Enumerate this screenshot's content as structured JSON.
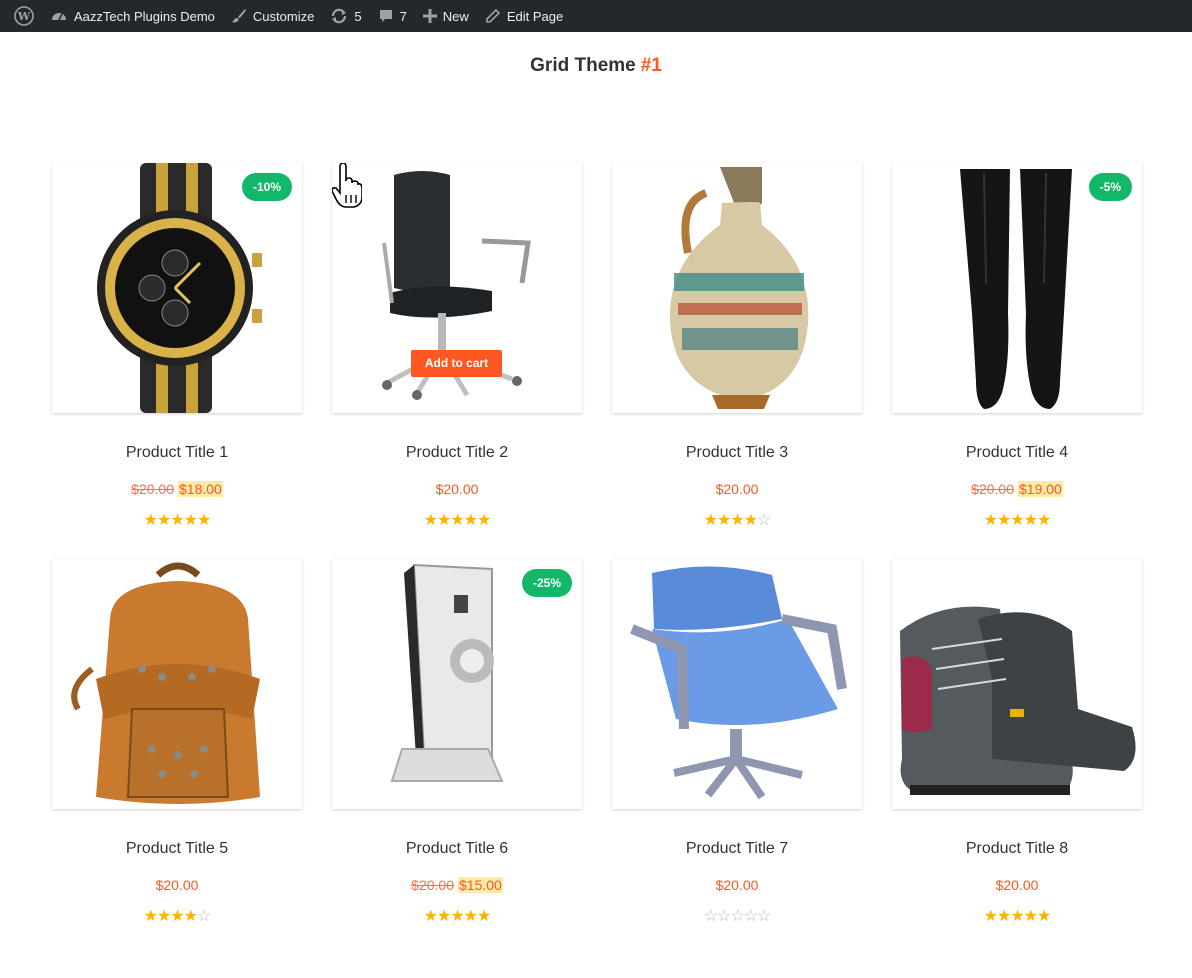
{
  "adminbar": {
    "site_name": "AazzTech Plugins Demo",
    "customize": "Customize",
    "updates": "5",
    "comments": "7",
    "new": "New",
    "edit": "Edit Page"
  },
  "heading": {
    "text": "Grid Theme",
    "accent": "#1"
  },
  "colors": {
    "accent": "#ff5722",
    "badge": "#12b76a",
    "star": "#ffb300"
  },
  "hover_button": "Add to cart",
  "products": [
    {
      "title": "Product Title 1",
      "old_price": "$20.00",
      "price": "$18.00",
      "badge": "-10%",
      "rating": 5,
      "image": "watch"
    },
    {
      "title": "Product Title 2",
      "old_price": "",
      "price": "$20.00",
      "badge": "",
      "rating": 5,
      "image": "office-chair"
    },
    {
      "title": "Product Title 3",
      "old_price": "",
      "price": "$20.00",
      "badge": "",
      "rating": 4,
      "image": "vase"
    },
    {
      "title": "Product Title 4",
      "old_price": "$20.00",
      "price": "$19.00",
      "badge": "-5%",
      "rating": 5,
      "image": "boots"
    },
    {
      "title": "Product Title 5",
      "old_price": "",
      "price": "$20.00",
      "badge": "",
      "rating": 4,
      "image": "backpack"
    },
    {
      "title": "Product Title 6",
      "old_price": "$20.00",
      "price": "$15.00",
      "badge": "-25%",
      "rating": 5,
      "image": "speaker"
    },
    {
      "title": "Product Title 7",
      "old_price": "",
      "price": "$20.00",
      "badge": "",
      "rating": 0,
      "image": "blue-chair"
    },
    {
      "title": "Product Title 8",
      "old_price": "",
      "price": "$20.00",
      "badge": "",
      "rating": 5,
      "image": "hiking-boots"
    }
  ]
}
